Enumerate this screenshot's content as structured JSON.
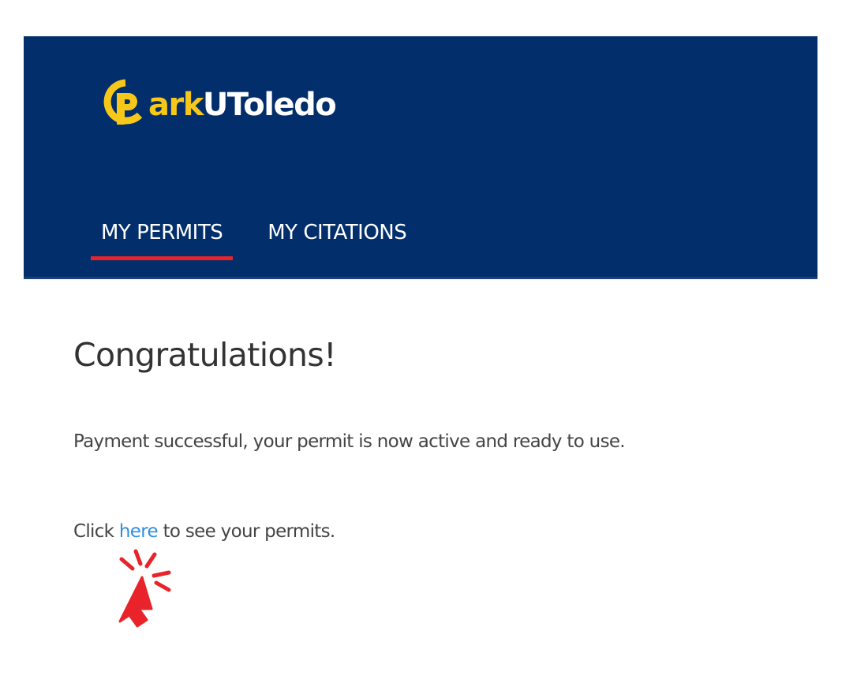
{
  "header": {
    "logo": {
      "letter": "P",
      "part1": "ark",
      "part2": "UToledo",
      "colors": {
        "yellow": "#f7c81a",
        "white": "#ffffff"
      }
    },
    "background_color": "#022f6b",
    "nav": [
      {
        "label": "MY PERMITS",
        "active": true
      },
      {
        "label": "MY CITATIONS",
        "active": false
      }
    ],
    "active_indicator_color": "#e8242a"
  },
  "main": {
    "title": "Congratulations!",
    "message": "Payment successful, your permit is now active and ready to use.",
    "cta": {
      "prefix": "Click ",
      "link_text": "here",
      "suffix": " to see your permits.",
      "link_color": "#2f8fe0"
    }
  },
  "overlay": {
    "icon": "click-pointer-icon",
    "color": "#e8242a"
  }
}
